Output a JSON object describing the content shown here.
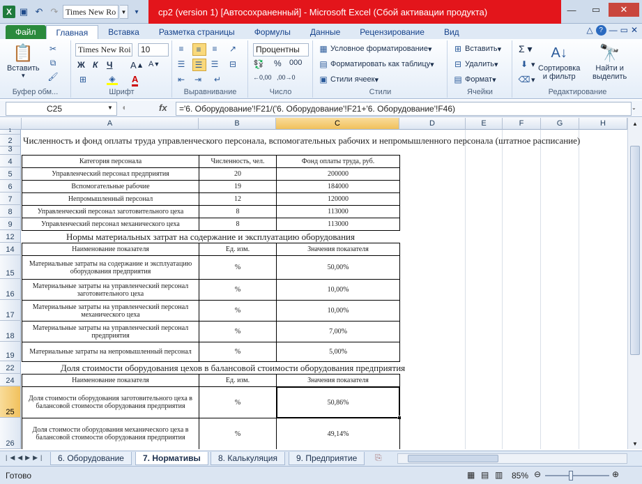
{
  "qat": {
    "font_value": "Times New Ro"
  },
  "window": {
    "title": "cp2 (version 1) [Автосохраненный]  -  Microsoft Excel (Сбой активации продукта)"
  },
  "tabs": [
    "Файл",
    "Главная",
    "Вставка",
    "Разметка страницы",
    "Формулы",
    "Данные",
    "Рецензирование",
    "Вид"
  ],
  "ribbon": {
    "clipboard": {
      "paste": "Вставить",
      "label": "Буфер обм..."
    },
    "font": {
      "name": "Times New Roi",
      "size": "10",
      "bold": "Ж",
      "italic": "К",
      "underline": "Ч",
      "label": "Шрифт"
    },
    "align": {
      "label": "Выравнивание"
    },
    "number": {
      "format": "Процентны",
      "label": "Число"
    },
    "styles": {
      "cond": "Условное форматирование",
      "table": "Форматировать как таблицу",
      "cell": "Стили ячеек",
      "label": "Стили"
    },
    "cells": {
      "insert": "Вставить",
      "delete": "Удалить",
      "format": "Формат",
      "label": "Ячейки"
    },
    "editing": {
      "sort1": "Сортировка",
      "sort2": "и фильтр",
      "find1": "Найти и",
      "find2": "выделить",
      "label": "Редактирование"
    }
  },
  "formula_bar": {
    "cell_ref": "C25",
    "fx": "fx",
    "formula": "='6. Оборудование'!F21/('6. Оборудование'!F21+'6. Оборудование'!F46)"
  },
  "columns": [
    "A",
    "B",
    "C",
    "D",
    "E",
    "F",
    "G",
    "H"
  ],
  "rows": [
    "1",
    "2",
    "3",
    "4",
    "5",
    "6",
    "7",
    "8",
    "9",
    "12",
    "14",
    "15",
    "16",
    "17",
    "18",
    "19",
    "22",
    "24",
    "25",
    "26"
  ],
  "sheet": {
    "title1": "Численность и фонд оплаты труда управленческого персонала, вспомогательных рабочих  и непромышленного персонала (штатное расписание)",
    "t1_head": [
      "Категория персонала",
      "Численность, чел.",
      "Фонд оплаты труда, руб."
    ],
    "t1_rows": [
      [
        "Управленческий персонал предприятия",
        "20",
        "200000"
      ],
      [
        "Вспомогательные рабочие",
        "19",
        "184000"
      ],
      [
        "Непромышленный персонал",
        "12",
        "120000"
      ],
      [
        "Управленческий персонал заготовительного цеха",
        "8",
        "113000"
      ],
      [
        "Управленческий персонал механического цеха",
        "8",
        "113000"
      ]
    ],
    "title2": "Нормы материальных затрат на содержание и эксплуатацию оборудования",
    "t2_head": [
      "Наименование показателя",
      "Ед. изм.",
      "Значения показателя"
    ],
    "t2_rows": [
      [
        "Материальные затраты на содержание и эксплуатацию оборудования предприятия",
        "%",
        "50,00%"
      ],
      [
        "Материальные затраты на управленческий персонал заготовительного цеха",
        "%",
        "10,00%"
      ],
      [
        "Материальные затраты на управленческий персонал механического цеха",
        "%",
        "10,00%"
      ],
      [
        "Материальные затраты на управленческий персонал предприятия",
        "%",
        "7,00%"
      ],
      [
        "Материальные затраты на непромышленный персонал",
        "%",
        "5,00%"
      ]
    ],
    "title3": "Доля стоимости оборудования цехов в балансовой стоимости оборудования предприятия",
    "t3_head": [
      "Наименование показателя",
      "Ед. изм.",
      "Значения показателя"
    ],
    "t3_rows": [
      [
        "Доля стоимости оборудования заготовительного цеха в балансовой стоимости оборудования предприятия",
        "%",
        "50,86%"
      ],
      [
        "Доля стоимости оборудования механического цеха в балансовой стоимости оборудования предприятия",
        "%",
        "49,14%"
      ]
    ]
  },
  "sheet_tabs": [
    "6. Оборудование",
    "7. Нормативы",
    "8. Калькуляция",
    "9. Предприятие"
  ],
  "status": {
    "ready": "Готово",
    "zoom": "85%"
  }
}
